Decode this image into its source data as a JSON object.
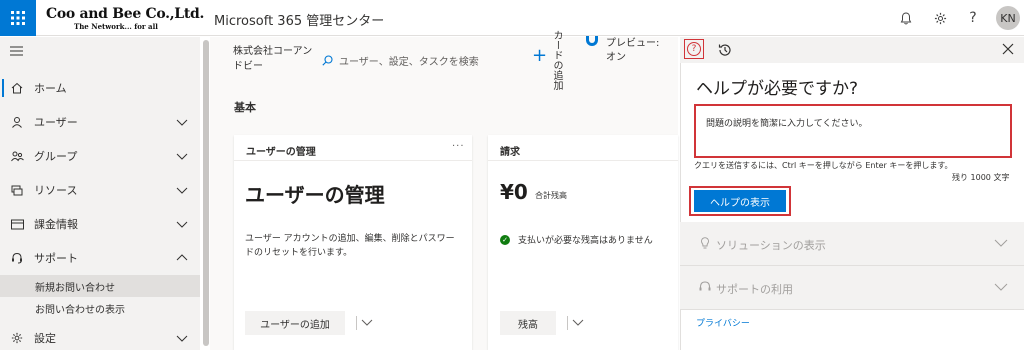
{
  "header": {
    "logo_main": "Coo and Bee Co.,Ltd.",
    "logo_sub": "The Network... for all",
    "app_title": "Microsoft 365 管理センター",
    "avatar_initials": "KN",
    "accent_color": "#0078d4"
  },
  "sidebar": {
    "items": [
      {
        "label": "ホーム",
        "icon": "home-icon"
      },
      {
        "label": "ユーザー",
        "icon": "user-icon"
      },
      {
        "label": "グループ",
        "icon": "group-icon"
      },
      {
        "label": "リソース",
        "icon": "resource-icon"
      },
      {
        "label": "課金情報",
        "icon": "billing-icon"
      },
      {
        "label": "サポート",
        "icon": "headset-icon"
      },
      {
        "label": "設定",
        "icon": "gear-icon"
      }
    ],
    "support_sub": [
      "新規お問い合わせ",
      "お問い合わせの表示"
    ]
  },
  "main": {
    "org_name": "株式会社コーアンドビー",
    "search_placeholder": "ユーザー、設定、タスクを検索",
    "add_card_label": "カードの追加",
    "preview_label": "プレビュー: オン",
    "section_title": "基本",
    "card_users": {
      "header": "ユーザーの管理",
      "title": "ユーザーの管理",
      "description": "ユーザー アカウントの追加、編集、削除とパスワードのリセットを行います。",
      "button": "ユーザーの追加"
    },
    "card_billing": {
      "header": "請求",
      "amount": "¥0",
      "amount_label": "合計残高",
      "status": "支払いが必要な残高はありません",
      "button": "残高"
    }
  },
  "help": {
    "title": "ヘルプが必要ですか?",
    "input_placeholder": "問題の説明を簡潔に入力してください。",
    "hint": "クエリを送信するには、Ctrl キーを押しながら Enter キーを押します。",
    "remaining": "残り 1000 文字",
    "button": "ヘルプの表示",
    "accordions": [
      "ソリューションの表示",
      "サポートの利用"
    ],
    "privacy": "プライバシー"
  }
}
